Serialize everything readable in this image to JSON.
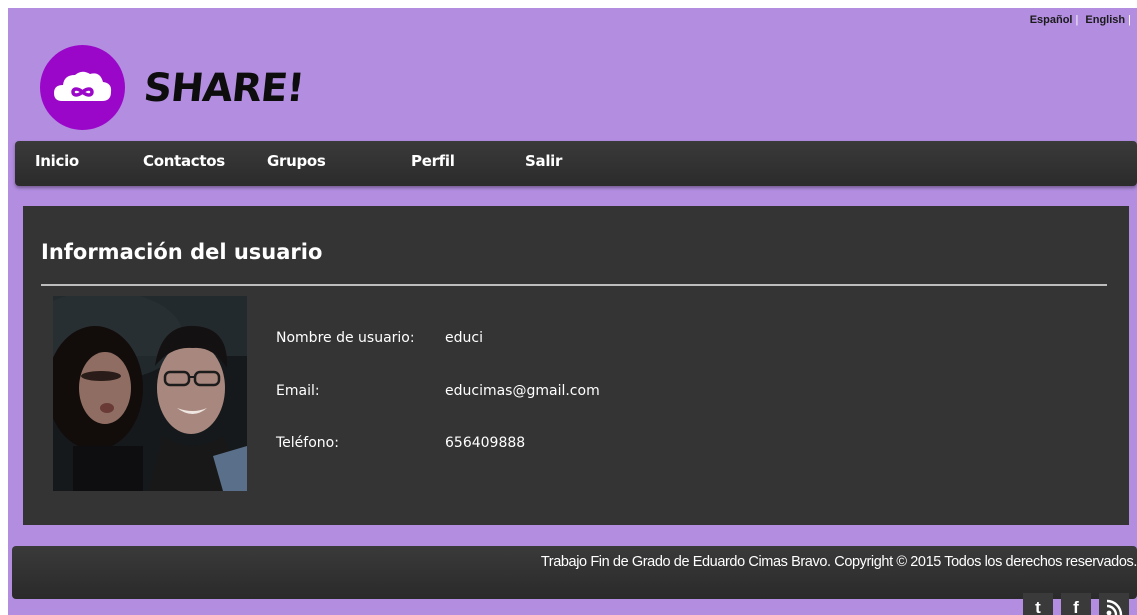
{
  "languages": [
    {
      "label": "Español"
    },
    {
      "label": "English"
    }
  ],
  "brand": {
    "name": "SHARE!",
    "logo_glyph": "∞",
    "logo_icon": "cloud-infinity-icon",
    "logo_color": "#9b07c9"
  },
  "nav": {
    "items": [
      {
        "label": "Inicio"
      },
      {
        "label": "Contactos"
      },
      {
        "label": "Grupos"
      },
      {
        "label": "Perfil"
      },
      {
        "label": "Salir"
      }
    ]
  },
  "profile": {
    "title": "Información del usuario",
    "photo": "user-profile-photo",
    "fields": [
      {
        "label": "Nombre de usuario:",
        "value": "educi"
      },
      {
        "label": "Email:",
        "value": "educimas@gmail.com"
      },
      {
        "label": "Teléfono:",
        "value": "656409888"
      }
    ]
  },
  "footer": {
    "text": "Trabajo Fin de Grado de Eduardo Cimas Bravo. Copyright © 2015 Todos los derechos reservados."
  },
  "social": [
    {
      "glyph": "t",
      "icon": "twitter-icon"
    },
    {
      "glyph": "f",
      "icon": "facebook-icon"
    },
    {
      "glyph": "ʀss",
      "icon": "rss-icon"
    }
  ],
  "colors": {
    "page_background": "#b28de0",
    "bar_background": "#333333",
    "text_light": "#ffffff"
  }
}
